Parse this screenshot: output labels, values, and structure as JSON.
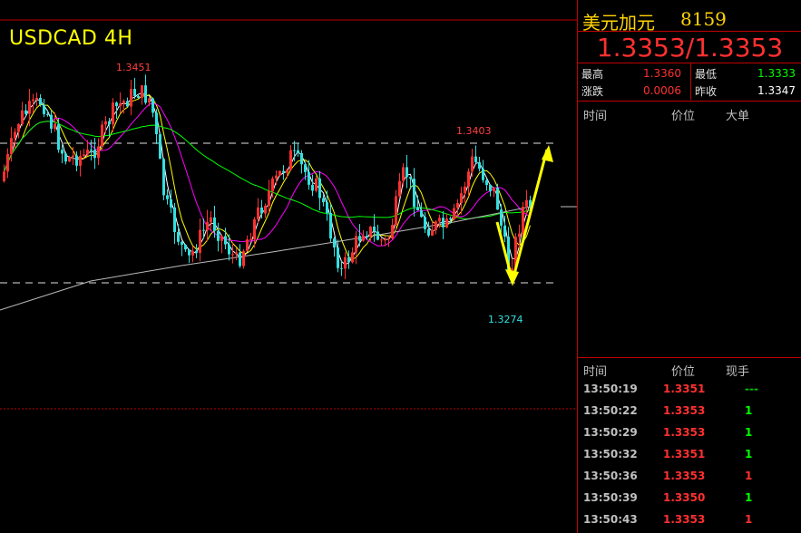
{
  "chart": {
    "title": "USDCAD 4H",
    "high_label": "1.3451",
    "resistance_label": "1.3403",
    "low_label": "1.3274"
  },
  "chart_data": {
    "type": "candlestick",
    "title": "USDCAD 4H",
    "annotations": [
      {
        "text": "1.3451",
        "kind": "period-high"
      },
      {
        "text": "1.3403",
        "kind": "resistance"
      },
      {
        "text": "1.3274",
        "kind": "period-low"
      }
    ],
    "colors": {
      "up": "#ff3030",
      "down": "#33e0e0",
      "ma_short": "#ffffff",
      "ma_mid": "#ffff00",
      "ma_long": "#ff00ff",
      "ma_120": "#00ff00",
      "ma_250": "#bbbbbb",
      "arrow": "#ffff00"
    }
  },
  "quote": {
    "name": "美元加元",
    "code": "8159",
    "bid": "1.3353",
    "separator": "/",
    "ask": "1.3353",
    "stats": {
      "high_label": "最高",
      "high": "1.3360",
      "low_label": "最低",
      "low": "1.3333",
      "change_label": "涨跌",
      "change": "0.0006",
      "prev_close_label": "昨收",
      "prev_close": "1.3347"
    },
    "big_orders_header": {
      "time": "时间",
      "price": "价位",
      "big": "大单"
    },
    "ticks_header": {
      "time": "时间",
      "price": "价位",
      "vol": "现手"
    },
    "ticks": [
      {
        "time": "13:50:19",
        "price": "1.3351",
        "vol": "---",
        "vol_color": "#00cc00"
      },
      {
        "time": "13:50:22",
        "price": "1.3353",
        "vol": "1",
        "vol_color": "#00ff00"
      },
      {
        "time": "13:50:29",
        "price": "1.3353",
        "vol": "1",
        "vol_color": "#00ff00"
      },
      {
        "time": "13:50:32",
        "price": "1.3351",
        "vol": "1",
        "vol_color": "#00ff00"
      },
      {
        "time": "13:50:36",
        "price": "1.3353",
        "vol": "1",
        "vol_color": "#ff3030"
      },
      {
        "time": "13:50:39",
        "price": "1.3350",
        "vol": "1",
        "vol_color": "#00ff00"
      },
      {
        "time": "13:50:43",
        "price": "1.3353",
        "vol": "1",
        "vol_color": "#ff3030"
      }
    ]
  }
}
